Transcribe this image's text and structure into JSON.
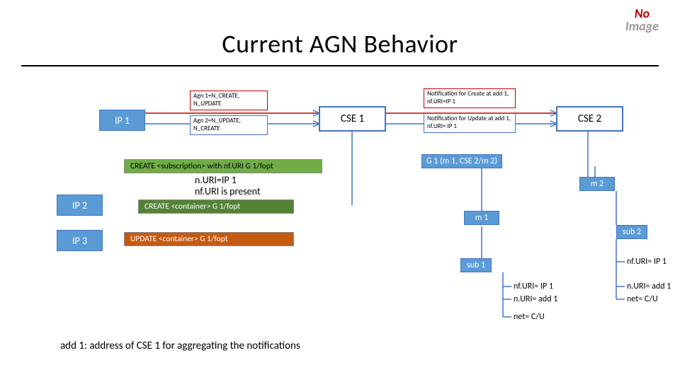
{
  "title": "Current AGN Behavior",
  "no_image": {
    "line1": "No",
    "line2": "Image"
  },
  "nodes": {
    "ip1": "IP 1",
    "ip2": "IP 2",
    "ip3": "IP 3",
    "cse1": "CSE 1",
    "cse2": "CSE 2"
  },
  "agn": {
    "agn1": "Agn 1=N_CREATE, N_UPDATE",
    "agn2": "Agn 2=N_UPDATE, N_CREATE",
    "ncreate": "Notification for Create at add 1, nf.URI=IP 1",
    "nupdate": "Notification for Update at add 1, nf.URI= IP 1"
  },
  "msgs": {
    "m1": "CREATE <subscription> with nf.URI G 1/fopt",
    "m2a": "n.URI=IP 1",
    "m2b": "nf.URI is present",
    "m3": "CREATE <container> G 1/fopt",
    "m4": "UPDATE <container> G 1/fopt"
  },
  "tree": {
    "g1": "G 1 (m 1, CSE 2/m 2)",
    "m1": "m 1",
    "m2": "m 2",
    "sub1": "sub 1",
    "sub2": "sub 2"
  },
  "sub1_attrs": {
    "a1": "nf.URI= IP 1",
    "a2": "n.URI= add 1",
    "a3": "net= C/U"
  },
  "sub2_attrs": {
    "a1": "nf.URI= IP 1",
    "a2": "n.URI= add 1",
    "a3": "net= C/U"
  },
  "footnote": "add 1: address of CSE 1 for aggregating the notifications"
}
